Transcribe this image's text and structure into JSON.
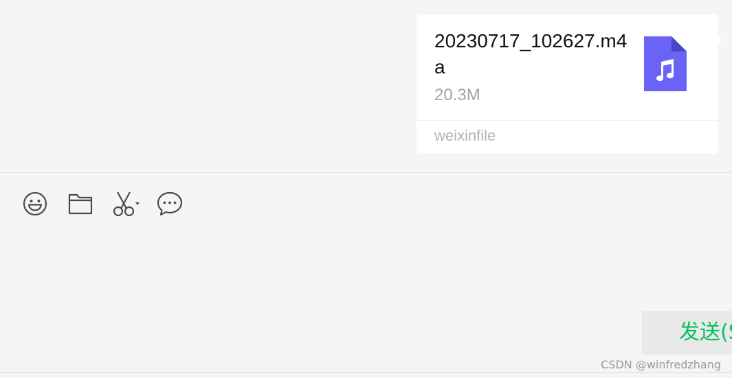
{
  "message": {
    "file_name": "20230717_102627.m4a",
    "file_size": "20.3M",
    "file_source": "weixinfile",
    "file_icon": "audio-file-icon",
    "icon_color": "#6a63f6"
  },
  "toolbar": {
    "items": [
      {
        "name": "emoji-icon"
      },
      {
        "name": "folder-icon"
      },
      {
        "name": "scissors-icon"
      },
      {
        "name": "chat-bubble-icon"
      }
    ]
  },
  "send": {
    "label": "发送(S"
  },
  "watermark": "CSDN @winfredzhang",
  "colors": {
    "accent": "#07c160",
    "background": "#f5f5f5",
    "bubble": "#ffffff"
  }
}
